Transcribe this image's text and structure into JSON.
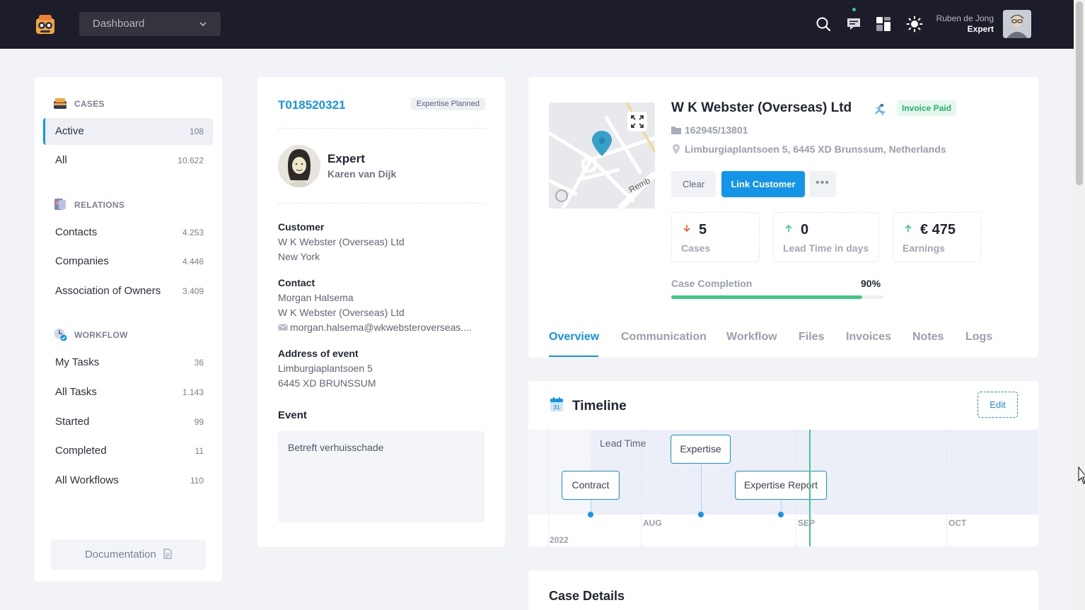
{
  "header": {
    "dashboard_select": "Dashboard",
    "user_name": "Ruben de Jong",
    "user_role": "Expert",
    "icons": [
      "search-icon",
      "chat-icon",
      "apps-icon",
      "sun-icon"
    ]
  },
  "sidebar": {
    "cases_heading": "CASES",
    "cases": [
      {
        "label": "Active",
        "count": "108"
      },
      {
        "label": "All",
        "count": "10.622"
      }
    ],
    "relations_heading": "RELATIONS",
    "relations": [
      {
        "label": "Contacts",
        "count": "4.253"
      },
      {
        "label": "Companies",
        "count": "4.446"
      },
      {
        "label": "Association of Owners",
        "count": "3.409"
      }
    ],
    "workflow_heading": "WORKFLOW",
    "workflow": [
      {
        "label": "My Tasks",
        "count": "36"
      },
      {
        "label": "All Tasks",
        "count": "1.143"
      },
      {
        "label": "Started",
        "count": "99"
      },
      {
        "label": "Completed",
        "count": "11"
      },
      {
        "label": "All Workflows",
        "count": "110"
      }
    ],
    "documentation": "Documentation"
  },
  "case": {
    "id": "T018520321",
    "status": "Expertise Planned",
    "expert_title": "Expert",
    "expert_name": "Karen van Dijk",
    "customer_label": "Customer",
    "customer_name": "W K Webster (Overseas) Ltd",
    "customer_city": "New York",
    "contact_label": "Contact",
    "contact_name": "Morgan Halsema",
    "contact_company": "W K Webster (Overseas) Ltd",
    "contact_email": "morgan.halsema@wkwebsteroverseas....",
    "address_label": "Address of event",
    "address_line1": "Limburgiaplantsoen 5",
    "address_line2": "6445 XD BRUNSSUM",
    "event_label": "Event",
    "event_text": "Betreft verhuisschade"
  },
  "company": {
    "name": "W K Webster (Overseas) Ltd",
    "badge": "Invoice Paid",
    "id": "162945/13801",
    "address": "Limburgiaplantsoen 5, 6445 XD Brunssum, Netherlands",
    "map_street": "Remb",
    "btn_clear": "Clear",
    "btn_link": "Link Customer",
    "btn_more": "•••",
    "stats": [
      {
        "value": "5",
        "label": "Cases",
        "trend": "down",
        "color": "#e8632b"
      },
      {
        "value": "0",
        "label": "Lead Time in days",
        "trend": "up",
        "color": "#3fc983"
      },
      {
        "value": "€ 475",
        "label": "Earnings",
        "trend": "up",
        "color": "#3fc983"
      }
    ],
    "completion_label": "Case Completion",
    "completion_pct": "90%",
    "completion_value": 0.9,
    "tabs": [
      "Overview",
      "Communication",
      "Workflow",
      "Files",
      "Invoices",
      "Notes",
      "Logs"
    ],
    "active_tab": "Overview"
  },
  "timeline": {
    "title": "Timeline",
    "edit": "Edit",
    "lead_label": "Lead Time",
    "milestones": [
      "Contract",
      "Expertise",
      "Expertise Report"
    ],
    "months": [
      "AUG",
      "SEP",
      "OCT"
    ],
    "year": "2022"
  },
  "case_details": {
    "title": "Case Details"
  },
  "colors": {
    "accent": "#1595e8",
    "success": "#3fc983",
    "topbar": "#1d1c2b"
  }
}
